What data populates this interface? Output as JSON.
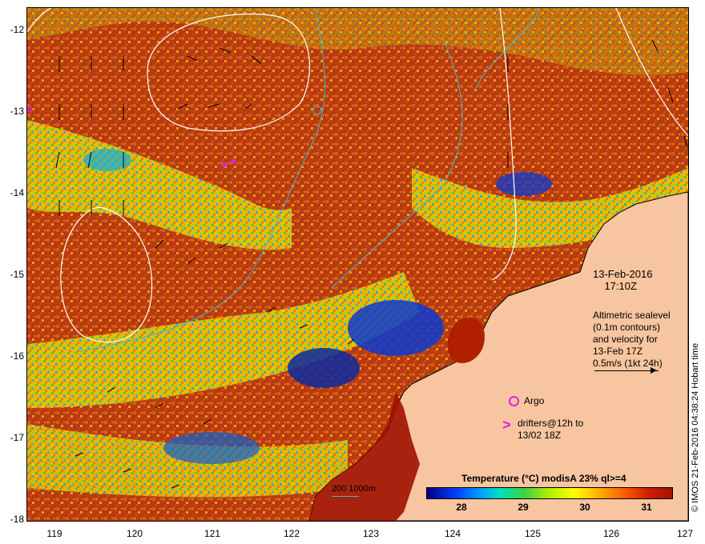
{
  "map": {
    "lon_ticks": [
      "119",
      "120",
      "121",
      "122",
      "123",
      "124",
      "125",
      "126",
      "127"
    ],
    "lat_ticks": [
      "-12",
      "-13",
      "-14",
      "-15",
      "-16",
      "-17",
      "-18"
    ],
    "date_label": "13-Feb-2016\n    17:10Z",
    "altimetry_note": "Altimetric sealevel\n(0.1m contours)\nand velocity for\n13-Feb 17Z\n0.5m/s (1kt 24h)",
    "argo_label": "Argo",
    "drifters_label": "drifters@12h to\n13/02 18Z",
    "depth_legend": "200  1000m",
    "credit": "© IMOS 21-Feb-2016 04:38:24 Hobart time",
    "colorbar_title": "Temperature  (°C) modisA 23% ql>=4",
    "colorbar_ticks": [
      "28",
      "29",
      "30",
      "31"
    ],
    "colors": {
      "land": "#f7c59f",
      "warm": "#b83a14",
      "contour_sealevel": "#ffffff",
      "contour_depth": "#3fb8c8",
      "argo": "#e020e0"
    }
  }
}
